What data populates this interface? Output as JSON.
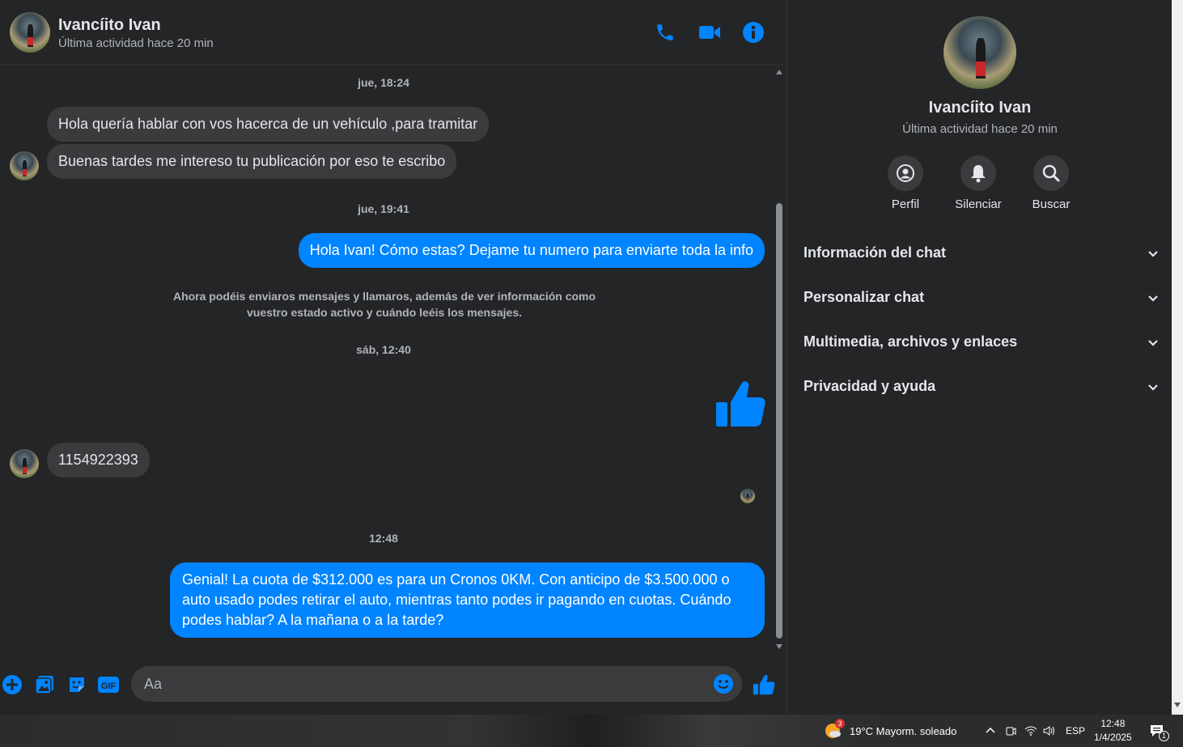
{
  "header": {
    "name": "Ivancíito Ivan",
    "status": "Última actividad hace 20 min",
    "icons": [
      "phone-icon",
      "video-icon",
      "info-icon"
    ]
  },
  "messages": {
    "ts1": "jue, 18:24",
    "m1": "Hola quería hablar con vos hacerca de un vehículo ,para tramitar",
    "m2": "Buenas tardes me intereso tu publicación por eso te escribo",
    "ts2": "jue, 19:41",
    "m3": "Hola Ivan! Cómo estas? Dejame tu numero para enviarte toda la info",
    "sys1": "Ahora podéis enviaros mensajes y llamaros, además de ver información como",
    "sys2": "vuestro estado activo y cuándo leéis los mensajes.",
    "ts3": "sáb, 12:40",
    "m4": "1154922393",
    "ts4": "12:48",
    "m5a": "Genial! La cuota de $312.000 es para un Cronos 0KM. Con anticipo de $3.500.000 o",
    "m5b": "auto usado podes retirar el auto, mientras tanto podes ir pagando en cuotas. Cuándo",
    "m5c": "podes hablar? A la mañana o a la tarde?"
  },
  "composer": {
    "placeholder": "Aa"
  },
  "sidebar": {
    "name": "Ivancíito Ivan",
    "status": "Última actividad hace 20 min",
    "actions": [
      {
        "label": "Perfil"
      },
      {
        "label": "Silenciar"
      },
      {
        "label": "Buscar"
      }
    ],
    "sections": [
      {
        "label": "Información del chat"
      },
      {
        "label": "Personalizar chat"
      },
      {
        "label": "Multimedia, archivos y enlaces"
      },
      {
        "label": "Privacidad y ayuda"
      }
    ]
  },
  "taskbar": {
    "weather_badge": "3",
    "weather": "19°C  Mayorm. soleado",
    "lang": "ESP",
    "time": "12:48",
    "date": "1/4/2025",
    "notif_count": "1"
  },
  "colors": {
    "accent": "#0084ff",
    "bg": "#242526",
    "bubble_in": "#3a3b3c"
  }
}
